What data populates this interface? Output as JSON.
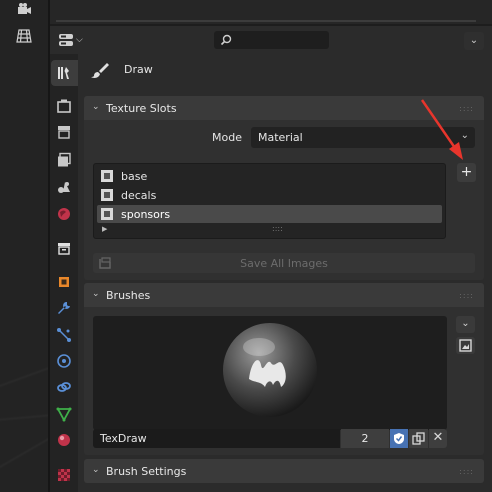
{
  "top_header": {
    "search_placeholder": ""
  },
  "tool": {
    "name": "Draw"
  },
  "texture_slots": {
    "title": "Texture Slots",
    "mode_label": "Mode",
    "mode_value": "Material",
    "slots": [
      {
        "label": "base"
      },
      {
        "label": "decals"
      },
      {
        "label": "sponsors",
        "selected": true
      }
    ],
    "add_label": "+",
    "save_all_label": "Save All Images"
  },
  "brushes": {
    "title": "Brushes",
    "name": "TexDraw",
    "users": "2"
  },
  "brush_settings": {
    "title": "Brush Settings"
  },
  "colors": {
    "accent": "#4772b3",
    "arrow": "#e8352c",
    "panel": "#303030",
    "header": "#3a3a3a"
  }
}
